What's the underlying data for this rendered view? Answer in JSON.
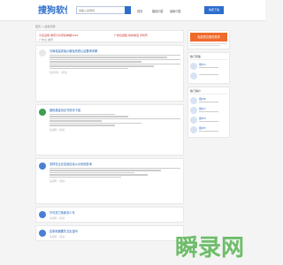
{
  "header": {
    "brand": "搜狗软件",
    "search_placeholder": "请输入关键词",
    "nav": [
      "首页",
      "路线问答",
      "最新问答"
    ],
    "download_label": "免费下载"
  },
  "breadcrumb": "首页 > 最新问题",
  "banner": {
    "left_top": "冷冻设施  重庆分享安检单据2024",
    "left_bottom": "广告位  推荐",
    "right_top": "广告位招租  热线电话  手机号"
  },
  "cards": [
    {
      "title": "冷库保温安装价格及资质认证要求详解",
      "meta": "某某问答 · 3天前"
    },
    {
      "title": "股权基金协议书范本下载",
      "meta": "某某网 · 5天前"
    },
    {
      "title": "怎样在企业信用信息公示系统查询",
      "meta": "某某网 · 7天前"
    },
    {
      "title": "不可抗力条款怎么写",
      "meta": "某某网 · 2天前"
    },
    {
      "title": "定制机器要先交定金吗",
      "meta": "某某网 · 1天前"
    }
  ],
  "sidebar": {
    "button_label": "免费提交服务需求",
    "popular_title": "热门问答",
    "users_title": "热门用户",
    "users": [
      "用户A",
      "用户B",
      "用户C",
      "用户D",
      "用户E"
    ]
  },
  "watermark": "瞬录网",
  "colors": {
    "brand": "#2d6dcc",
    "cta": "#f06a2c",
    "watermark": "#5fb85a"
  }
}
